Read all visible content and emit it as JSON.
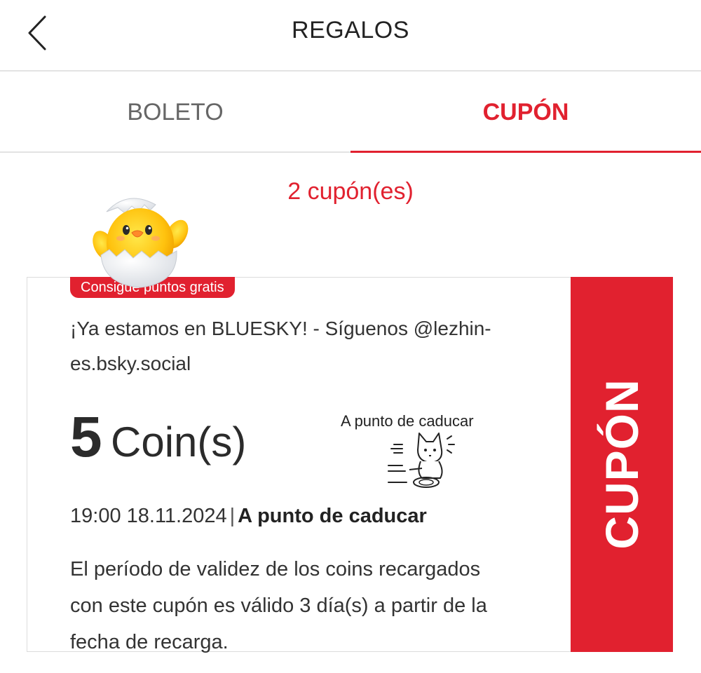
{
  "header": {
    "title": "REGALOS",
    "back_icon": "chevron-left-icon"
  },
  "tabs": [
    {
      "label": "BOLETO",
      "active": false
    },
    {
      "label": "CUPÓN",
      "active": true
    }
  ],
  "coupon_count": "2 cupón(es)",
  "colors": {
    "accent": "#e1212f",
    "divider": "#e3e3e3",
    "text": "#222222"
  },
  "coupon": {
    "badge": "Consigue puntos gratis",
    "title": "¡Ya estamos en BLUESKY! - Síguenos @lezhin-es.bsky.social",
    "amount": "5",
    "unit": "Coin(s)",
    "expire_label": "A punto de caducar",
    "date": "19:00 18.11.2024",
    "separator": "|",
    "status": "A punto de caducar",
    "description": "El período de validez de los coins recargados con este cupón es válido 3 día(s) a partir de la fecha de recarga.",
    "stub_label": "CUPÓN",
    "mascot_icon": "hatching-chick-icon",
    "illustration_icon": "running-cat-icon"
  }
}
